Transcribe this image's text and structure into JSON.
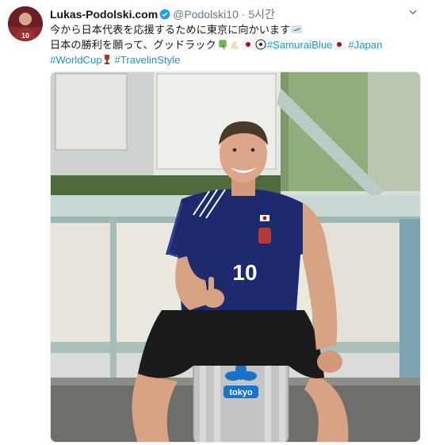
{
  "tweet": {
    "display_name": "Lukas-Podolski.com",
    "handle": "@Podolski10",
    "separator": "·",
    "time": "5시간",
    "line1_text": "今から日本代表を応援するために東京に向かいます",
    "line2_text": "日本の勝利を願って、グッドラック",
    "hashtag_samurai": "#SamuraiBlue",
    "hashtag_japan": "#Japan",
    "hashtag_worldcup": "#WorldCup",
    "hashtag_travel": "#TravelinStyle",
    "icons": [
      "verified-badge-icon",
      "chevron-down-icon",
      "plane-emoji-icon",
      "clover-emoji-icon",
      "flexed-arm-emoji-icon",
      "japan-flag-emoji-icon",
      "soccer-ball-emoji-icon",
      "trophy-emoji-icon"
    ],
    "photo": {
      "jersey_number": "10",
      "suitcase_label": "tokyo"
    }
  },
  "colors": {
    "link": "#1b95e0",
    "meta": "#657786",
    "verified": "#1da1f2",
    "jersey": "#1e2a6e"
  }
}
